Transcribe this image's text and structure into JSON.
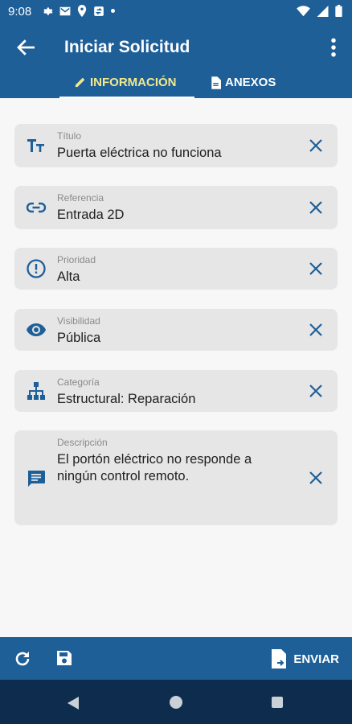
{
  "status_bar": {
    "time": "9:08"
  },
  "app_bar": {
    "title": "Iniciar Solicitud"
  },
  "tabs": [
    {
      "label": "INFORMACIÓN",
      "icon": "pencil-icon",
      "active": true
    },
    {
      "label": "ANEXOS",
      "icon": "document-icon",
      "active": false
    }
  ],
  "fields": [
    {
      "label": "Título",
      "value": "Puerta eléctrica no funciona",
      "icon": "text-format-icon"
    },
    {
      "label": "Referencia",
      "value": "Entrada 2D",
      "icon": "link-icon"
    },
    {
      "label": "Prioridad",
      "value": "Alta",
      "icon": "alert-circle-icon"
    },
    {
      "label": "Visibilidad",
      "value": "Pública",
      "icon": "eye-icon"
    },
    {
      "label": "Categoría",
      "value": "Estructural: Reparación",
      "icon": "hierarchy-icon"
    },
    {
      "label": "Descripción",
      "value": "El portón eléctrico no responde a ningún control remoto.",
      "icon": "message-icon"
    }
  ],
  "bottom_bar": {
    "send_label": "ENVIAR"
  },
  "colors": {
    "primary": "#1e5f98",
    "accent": "#f3e98a",
    "field_bg": "#e6e6e6",
    "nav_bg": "#0e2d4e"
  }
}
